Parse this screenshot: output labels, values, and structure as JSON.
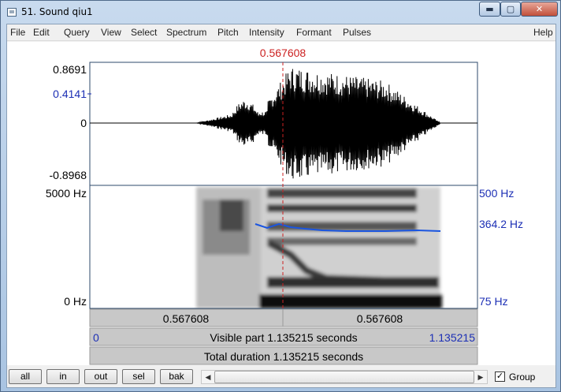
{
  "window": {
    "title": "51. Sound qiu1",
    "min_glyph": "▬",
    "max_glyph": "▢",
    "close_glyph": "✕"
  },
  "menu": {
    "items": [
      "File",
      "Edit",
      "Query",
      "View",
      "Select",
      "Spectrum",
      "Pitch",
      "Intensity",
      "Formant",
      "Pulses"
    ],
    "help": "Help"
  },
  "cursor": {
    "time": "0.567608",
    "color": "#cc2222"
  },
  "waveform": {
    "y_max": "0.8691",
    "y_cursor": "0.4141",
    "y_zero": "0",
    "y_min": "-0.8968"
  },
  "spectrogram": {
    "freq_max": "5000 Hz",
    "freq_min": "0 Hz",
    "pitch_top": "500 Hz",
    "pitch_value": "364.2 Hz",
    "pitch_bottom": "75 Hz",
    "pitch_color": "#1a55e0"
  },
  "bars": {
    "row1_left": "0.567608",
    "row1_right": "0.567608",
    "row2_start": "0",
    "row2_text": "Visible part 1.135215 seconds",
    "row2_end": "1.135215",
    "row3_text": "Total duration 1.135215 seconds"
  },
  "buttons": {
    "all": "all",
    "in": "in",
    "out": "out",
    "sel": "sel",
    "bak": "bak"
  },
  "scroll": {
    "left_arrow": "◀",
    "right_arrow": "▶"
  },
  "group": {
    "label": "Group",
    "checked": true,
    "check_glyph": "✓"
  },
  "colors": {
    "blue_label": "#1c2fb5",
    "red_cursor": "#cc2222"
  }
}
